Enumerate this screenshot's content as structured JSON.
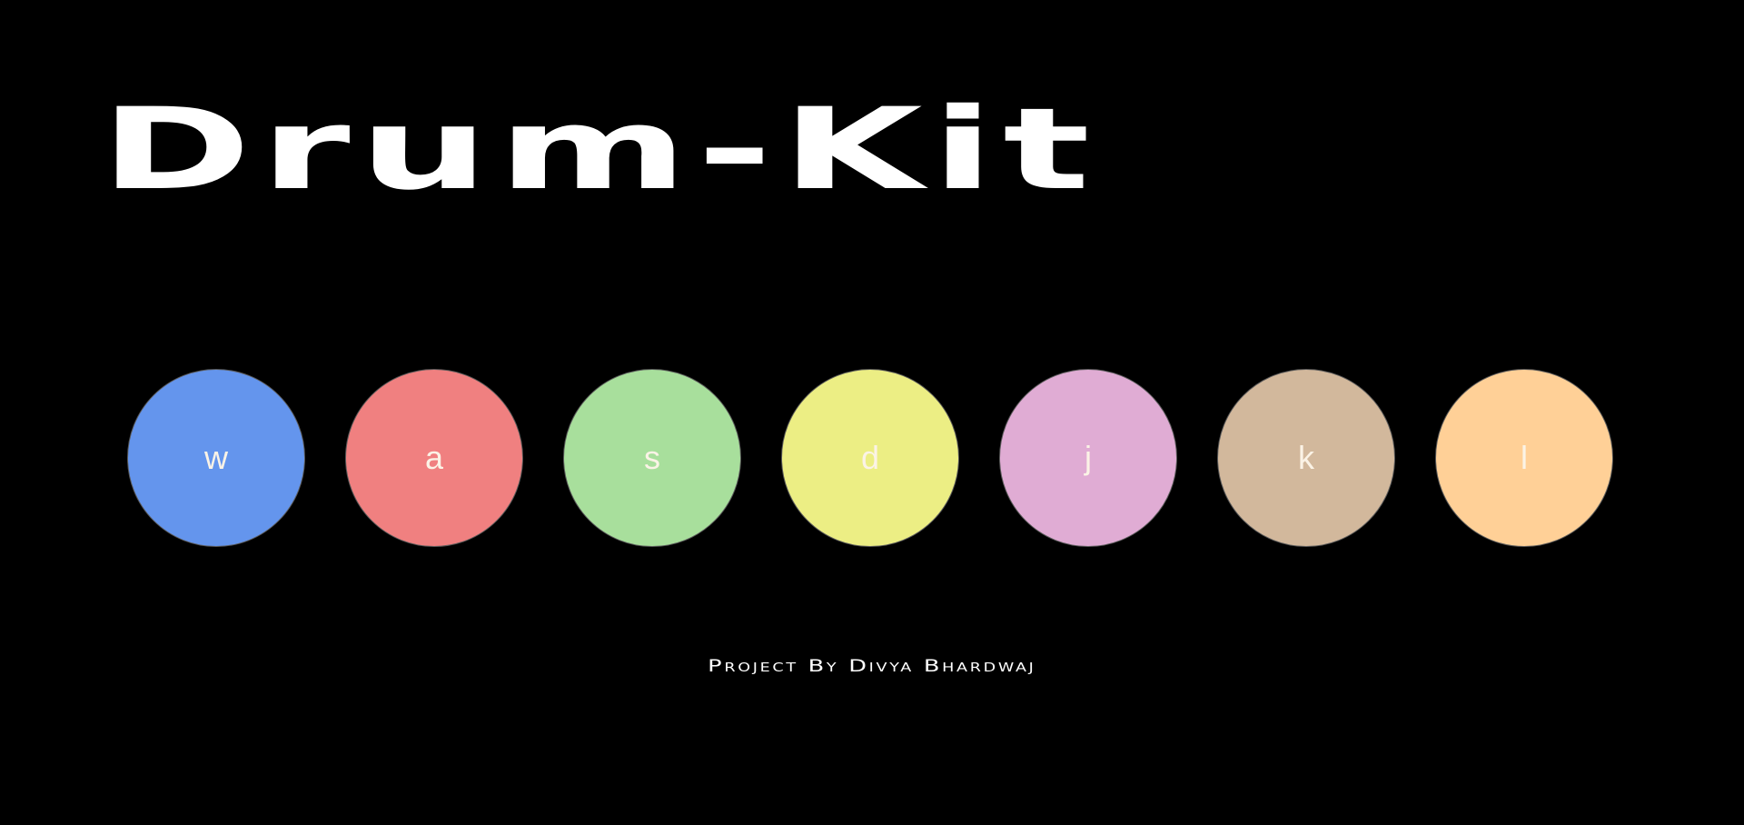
{
  "header": {
    "title": "Drum-Kit"
  },
  "pads": [
    {
      "key": "w",
      "color": "#6495ed"
    },
    {
      "key": "a",
      "color": "#f08080"
    },
    {
      "key": "s",
      "color": "#a8df9c"
    },
    {
      "key": "d",
      "color": "#ecee84"
    },
    {
      "key": "j",
      "color": "#e0acd4"
    },
    {
      "key": "k",
      "color": "#d2b89c"
    },
    {
      "key": "l",
      "color": "#ffd097"
    }
  ],
  "footer": {
    "credit": "Project By Divya Bhardwaj"
  },
  "colors": {
    "background": "#000000",
    "text": "#ffffff",
    "pad_label": "#fbf3e6"
  }
}
